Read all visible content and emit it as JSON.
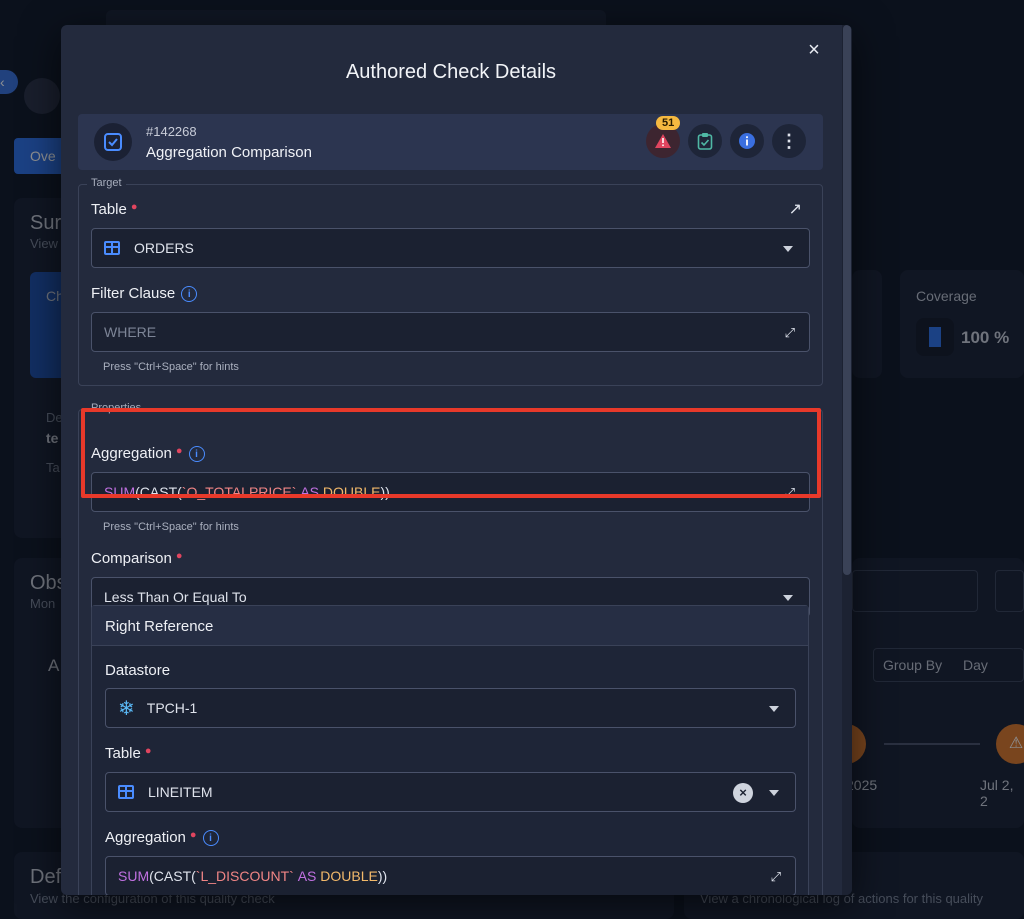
{
  "background": {
    "overview_tab": "Ove",
    "summary_title": "Sur",
    "summary_sub": "View",
    "card_ch": "Ch",
    "det_label": "De",
    "det_te": "te",
    "det_ta": "Ta",
    "obs_title": "Obs",
    "obs_sub": "Mon",
    "obs_a": "A",
    "coverage_label": "Coverage",
    "coverage_value": "100 %",
    "group_by_label": "Group By",
    "group_by_value": "Day",
    "date_1": "2025",
    "date_2": "Jul 2, 2",
    "def_title": "Def",
    "def_sub": "View the configuration of this quality check",
    "activity_sub": "View a chronological log of actions for this quality"
  },
  "modal": {
    "title": "Authored Check Details",
    "close": "×",
    "check": {
      "id": "#142268",
      "name": "Aggregation Comparison",
      "alert_count": "51"
    },
    "target": {
      "legend": "Target",
      "table_label": "Table",
      "table_value": "ORDERS",
      "filter_label": "Filter Clause",
      "filter_placeholder": "WHERE",
      "hint": "Press \"Ctrl+Space\" for hints"
    },
    "properties": {
      "legend": "Properties",
      "aggregation_label": "Aggregation",
      "aggregation_expr": {
        "fn": "SUM",
        "open": "(CAST(",
        "col": "`O_TOTALPRICE`",
        "as": "AS",
        "type": "DOUBLE",
        "close": "))"
      },
      "hint": "Press \"Ctrl+Space\" for hints",
      "comparison_label": "Comparison",
      "comparison_value": "Less Than Or Equal To"
    },
    "right_reference": {
      "title": "Right Reference",
      "datastore_label": "Datastore",
      "datastore_value": "TPCH-1",
      "table_label": "Table",
      "table_value": "LINEITEM",
      "aggregation_label": "Aggregation",
      "aggregation_expr": {
        "fn": "SUM",
        "open": "(CAST(",
        "col": "`L_DISCOUNT`",
        "as": "AS",
        "type": "DOUBLE",
        "close": "))"
      }
    }
  },
  "colors": {
    "accent": "#4a8cff",
    "highlight": "#e8392a",
    "required": "#e0455f",
    "badge": "#f5b940"
  }
}
